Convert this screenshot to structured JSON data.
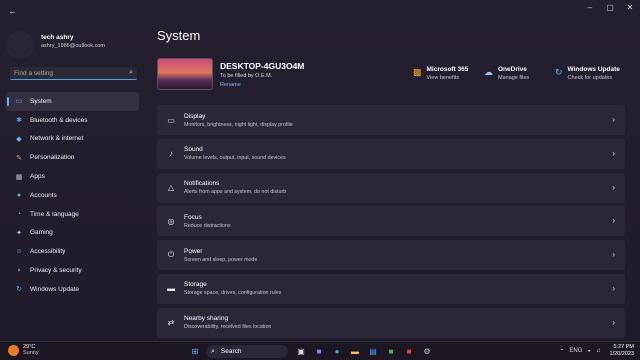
{
  "window": {
    "controls": [
      "–",
      "▢",
      "✕"
    ],
    "back": "←"
  },
  "profile": {
    "name": "tech ashry",
    "email": "ashry_1986@outlook.com"
  },
  "search": {
    "placeholder": "Find a setting"
  },
  "nav": [
    {
      "label": "System",
      "icon": "monitor-icon",
      "glyph": "▭",
      "color": "#5ab0ff",
      "active": true
    },
    {
      "label": "Bluetooth & devices",
      "icon": "bluetooth-icon",
      "glyph": "✱",
      "color": "#4aa3ff"
    },
    {
      "label": "Network & internet",
      "icon": "wifi-icon",
      "glyph": "◆",
      "color": "#6ab8ff"
    },
    {
      "label": "Personalization",
      "icon": "brush-icon",
      "glyph": "✎",
      "color": "#e6a05a"
    },
    {
      "label": "Apps",
      "icon": "apps-icon",
      "glyph": "▦",
      "color": "#c0c0c0"
    },
    {
      "label": "Accounts",
      "icon": "person-icon",
      "glyph": "●",
      "color": "#4fc3a0"
    },
    {
      "label": "Time & language",
      "icon": "globe-icon",
      "glyph": "◔",
      "color": "#5ab0ff"
    },
    {
      "label": "Gaming",
      "icon": "gamepad-icon",
      "glyph": "✦",
      "color": "#c8c8c8"
    },
    {
      "label": "Accessibility",
      "icon": "accessibility-icon",
      "glyph": "☺",
      "color": "#5ab0ff"
    },
    {
      "label": "Privacy & security",
      "icon": "shield-icon",
      "glyph": "◗",
      "color": "#9a9aa8"
    },
    {
      "label": "Windows Update",
      "icon": "update-icon",
      "glyph": "↻",
      "color": "#5ab0ff"
    }
  ],
  "main": {
    "title": "System",
    "device": {
      "name": "DESKTOP-4GU3O4M",
      "subtitle": "To be filled by O.E.M.",
      "rename": "Rename"
    },
    "quick": [
      {
        "title": "Microsoft 365",
        "sub": "View benefits",
        "icon": "microsoft-365-icon",
        "glyph": "▩",
        "color": "#f3a33a"
      },
      {
        "title": "OneDrive",
        "sub": "Manage files",
        "icon": "onedrive-icon",
        "glyph": "☁",
        "color": "#8ec6ff"
      },
      {
        "title": "Windows Update",
        "sub": "Check for updates",
        "icon": "windows-update-icon",
        "glyph": "↻",
        "color": "#5ab0ff"
      }
    ],
    "cards": [
      {
        "title": "Display",
        "sub": "Monitors, brightness, night light, display profile",
        "icon": "display-icon",
        "glyph": "▭"
      },
      {
        "title": "Sound",
        "sub": "Volume levels, output, input, sound devices",
        "icon": "speaker-icon",
        "glyph": "♪"
      },
      {
        "title": "Notifications",
        "sub": "Alerts from apps and system, do not disturb",
        "icon": "bell-icon",
        "glyph": "△"
      },
      {
        "title": "Focus",
        "sub": "Reduce distractions",
        "icon": "focus-icon",
        "glyph": "◎"
      },
      {
        "title": "Power",
        "sub": "Screen and sleep, power mode",
        "icon": "power-icon",
        "glyph": "⏻"
      },
      {
        "title": "Storage",
        "sub": "Storage space, drives, configuration rules",
        "icon": "storage-icon",
        "glyph": "▬"
      },
      {
        "title": "Nearby sharing",
        "sub": "Discoverability, received files location",
        "icon": "share-icon",
        "glyph": "⇄"
      }
    ],
    "chevron": "›"
  },
  "taskbar": {
    "weather_temp": "29°C",
    "weather_desc": "Sunny",
    "search_label": "Search",
    "apps": [
      {
        "icon": "windows-start-icon",
        "glyph": "⊞",
        "color": "#5ab0ff"
      },
      {
        "icon": "task-view-icon",
        "glyph": "▣",
        "color": "#dddddd"
      },
      {
        "icon": "chat-icon",
        "glyph": "■",
        "color": "#8a7cff"
      },
      {
        "icon": "edge-icon",
        "glyph": "●",
        "color": "#2fb5d8"
      },
      {
        "icon": "file-explorer-icon",
        "glyph": "▬",
        "color": "#f2c14e"
      },
      {
        "icon": "store-icon",
        "glyph": "▤",
        "color": "#4aa3ff"
      },
      {
        "icon": "camtasia-icon",
        "glyph": "■",
        "color": "#3dbb5c"
      },
      {
        "icon": "recorder-icon",
        "glyph": "■",
        "color": "#e0443c"
      },
      {
        "icon": "settings-icon",
        "glyph": "⚙",
        "color": "#c8c8c8"
      }
    ],
    "lang": "ENG",
    "time": "5:27 PM",
    "date": "1/20/2023"
  }
}
